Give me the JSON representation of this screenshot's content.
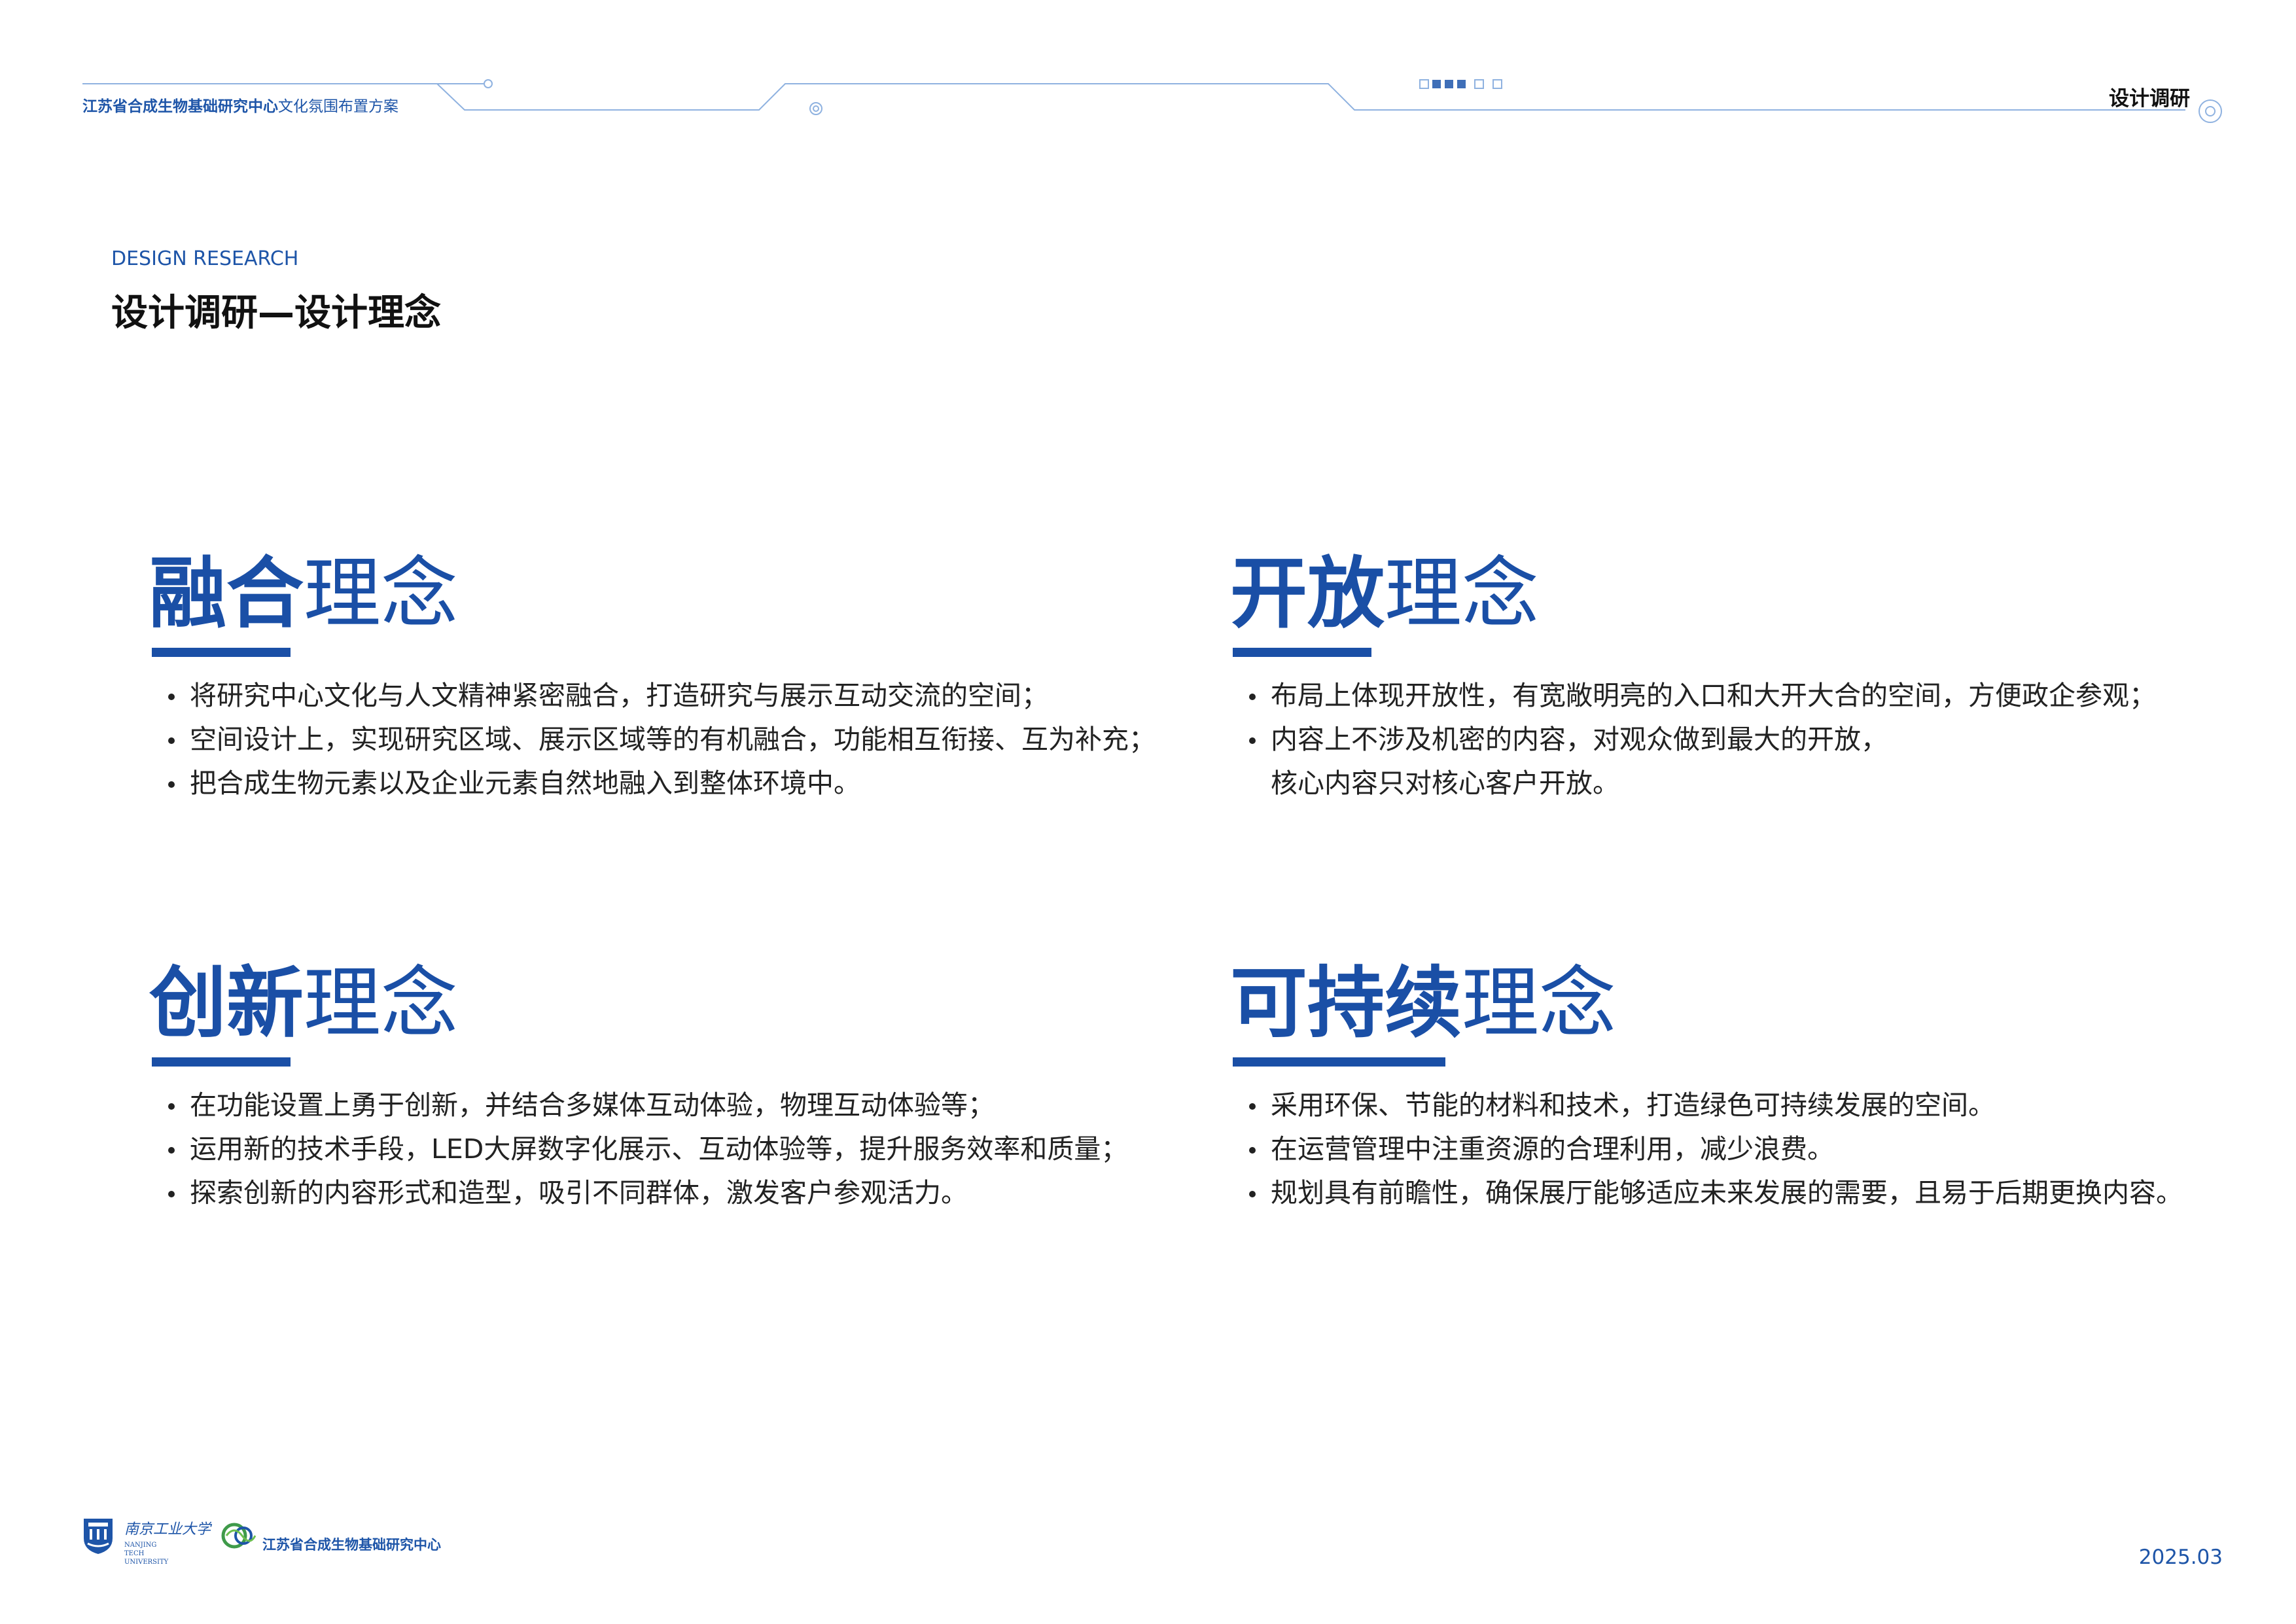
{
  "header": {
    "title_bold": "江苏省合成生物基础研究中心",
    "title_rest": "文化氛围布置方案",
    "section_label": "设计调研"
  },
  "subtitle_en": "DESIGN RESEARCH",
  "page_title": "设计调研—设计理念",
  "blocks": [
    {
      "heading_strong": "融合",
      "heading_light": "理念",
      "lines": [
        "将研究中心文化与人文精神紧密融合，打造研究与展示互动交流的空间；",
        "空间设计上，实现研究区域、展示区域等的有机融合，功能相互衔接、互为补充；",
        "把合成生物元素以及企业元素自然地融入到整体环境中。"
      ]
    },
    {
      "heading_strong": "开放",
      "heading_light": "理念",
      "lines": [
        "布局上体现开放性，有宽敞明亮的入口和大开大合的空间，方便政企参观；",
        "内容上不涉及机密的内容，对观众做到最大的开放，",
        "核心内容只对核心客户开放。"
      ]
    },
    {
      "heading_strong": "创新",
      "heading_light": "理念",
      "lines": [
        "在功能设置上勇于创新，并结合多媒体互动体验，物理互动体验等；",
        "运用新的技术手段，LED大屏数字化展示、互动体验等，提升服务效率和质量；",
        "探索创新的内容形式和造型，吸引不同群体，激发客户参观活力。"
      ]
    },
    {
      "heading_strong": "可持续",
      "heading_light": "理念",
      "lines": [
        "采用环保、节能的材料和技术，打造绿色可持续发展的空间。",
        "在运营管理中注重资源的合理利用，减少浪费。",
        "规划具有前瞻性，确保展厅能够适应未来发展的需要，且易于后期更换内容。"
      ]
    }
  ],
  "footer": {
    "university_name_cn": "南京工业大学",
    "university_name_en": "NANJING TECH UNIVERSITY",
    "center_name": "江苏省合成生物基础研究中心",
    "date": "2025.03"
  },
  "colors": {
    "brand_blue": "#1a4fa6",
    "line_blue": "#7aa3d8",
    "text": "#222222"
  }
}
